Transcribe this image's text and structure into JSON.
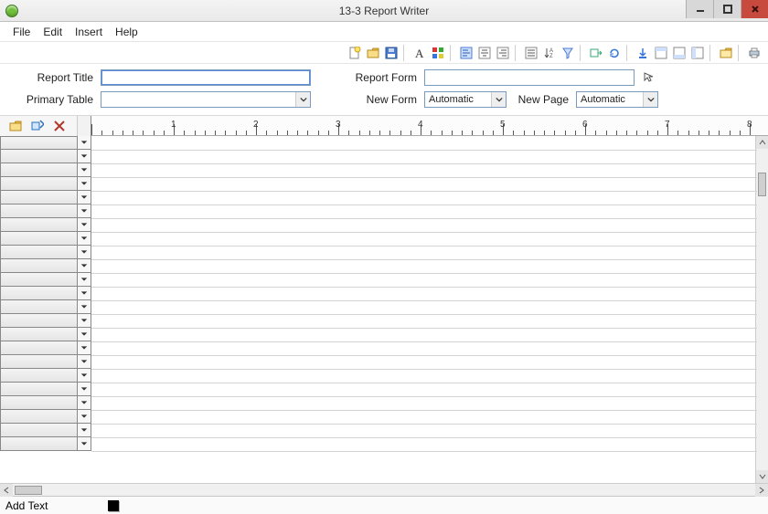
{
  "window": {
    "title": "13-3 Report Writer"
  },
  "menu": [
    "File",
    "Edit",
    "Insert",
    "Help"
  ],
  "toolbar_icons": [
    "new-icon",
    "open-icon",
    "save-icon",
    "sep",
    "text-icon",
    "palette-icon",
    "sep",
    "align-left-icon",
    "align-center-icon",
    "align-right-icon",
    "sep",
    "list-icon",
    "sort-icon",
    "filter-icon",
    "sep",
    "export-icon",
    "refresh-icon",
    "sep",
    "move-down-icon",
    "col1-icon",
    "col2-icon",
    "col3-icon",
    "sep",
    "folder-icon",
    "sep",
    "print-icon"
  ],
  "fields": {
    "report_title_label": "Report Title",
    "report_title_value": "",
    "primary_table_label": "Primary Table",
    "primary_table_value": "",
    "report_form_label": "Report Form",
    "report_form_value": "",
    "new_form_label": "New Form",
    "new_form_value": "Automatic",
    "new_page_label": "New Page",
    "new_page_value": "Automatic"
  },
  "ruler": {
    "units": 8,
    "subdivisions": 8
  },
  "rows": 23,
  "status": {
    "text": "Add Text"
  }
}
